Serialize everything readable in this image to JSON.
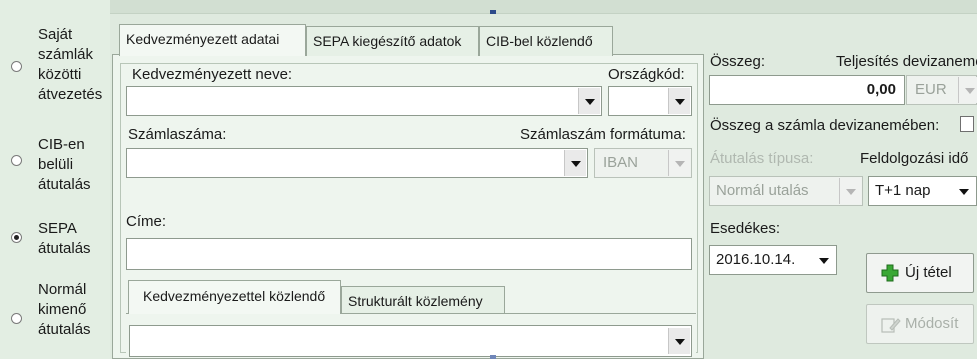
{
  "payment_types": [
    {
      "label": "Saját\nszámlák\nközötti\nátvezetés",
      "checked": false
    },
    {
      "label": "CIB-en\nbelüli\nátutalás",
      "checked": false
    },
    {
      "label": "SEPA\nátutalás",
      "checked": true
    },
    {
      "label": "Normál\nkimenő\nátutalás",
      "checked": false
    }
  ],
  "tabs": {
    "beneficiary": "Kedvezményezett adatai",
    "sepa": "SEPA kiegészítő adatok",
    "cib": "CIB-bel közlendő"
  },
  "form": {
    "beneficiary_name_label": "Kedvezményezett neve:",
    "country_code_label": "Országkód:",
    "account_number_label": "Számlaszáma:",
    "account_format_label": "Számlaszám formátuma:",
    "account_format_value": "IBAN",
    "address_label": "Címe:"
  },
  "message_tabs": {
    "beneficiary_message": "Kedvezményezettel közlendő",
    "structured_message": "Strukturált közlemény"
  },
  "right": {
    "amount_label": "Összeg:",
    "currency_label": "Teljesítés devizaneme",
    "amount_value": "0,00",
    "currency_value": "EUR",
    "account_currency_label": "Összeg a számla devizanemében:",
    "transfer_type_label": "Átutalás típusa:",
    "transfer_type_value": "Normál utalás",
    "processing_time_label": "Feldolgozási idő",
    "processing_time_value": "T+1 nap",
    "due_date_label": "Esedékes:",
    "due_date_value": "2016.10.14.",
    "new_item_button": "Új tétel",
    "modify_button": "Módosít"
  },
  "icons": {
    "new_item": "green-plus-icon",
    "modify": "edit-icon"
  },
  "colors": {
    "background": "#dfeadf",
    "panel": "#eef5ee",
    "plus_green": "#2e9c2a"
  }
}
